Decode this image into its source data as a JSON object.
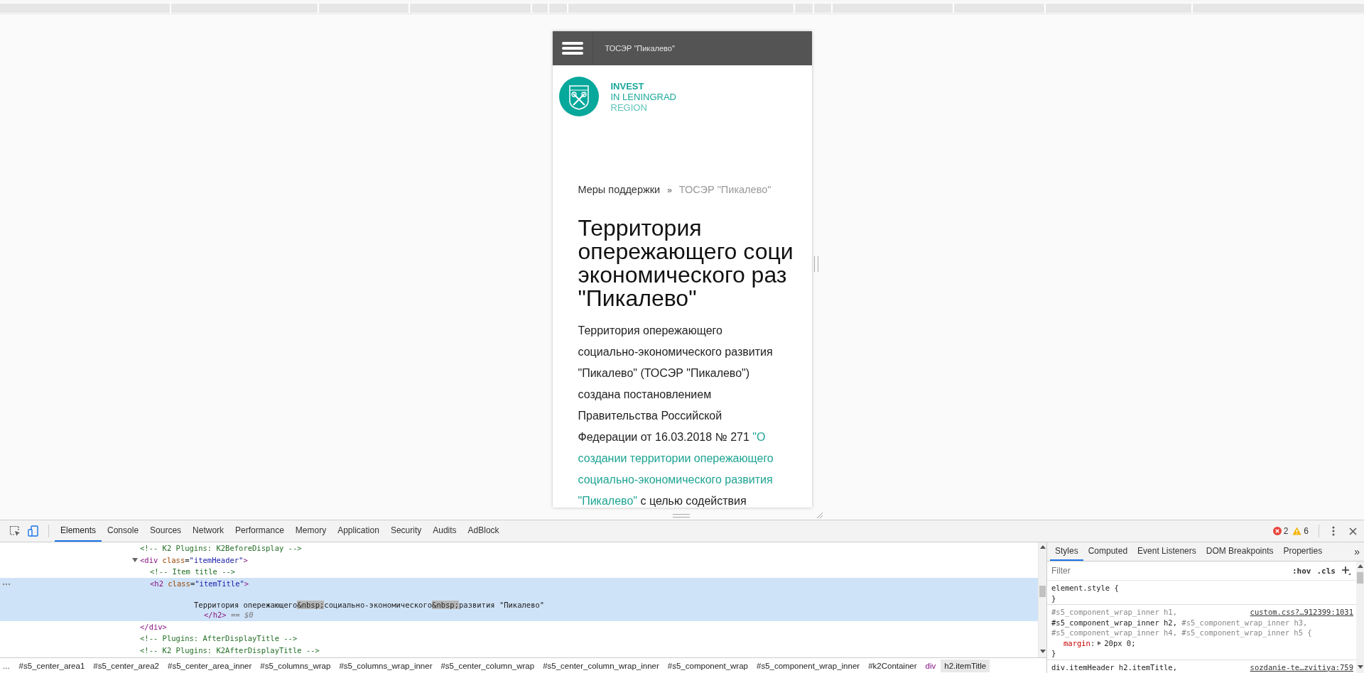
{
  "page": {
    "header": {
      "title": "ТОСЭР \"Пикалево\""
    },
    "logo": {
      "lines": [
        "INVEST",
        "IN LENINGRAD",
        "REGION"
      ]
    },
    "breadcrumb": [
      {
        "label": "Меры поддержки",
        "current": false
      },
      {
        "label": "ТОСЭР \"Пикалево\"",
        "current": true
      }
    ],
    "breadcrumb_separator": "»",
    "title_lines": [
      "Территория",
      "опережающего соци",
      "экономического раз",
      "\"Пикалево\""
    ],
    "paragraph_lines": [
      [
        {
          "text": "Территория опережающего",
          "kind": "text"
        }
      ],
      [
        {
          "text": "социально-экономического развития",
          "kind": "text"
        }
      ],
      [
        {
          "text": "\"Пикалево\" (ТОСЭР \"Пикалево\")",
          "kind": "text"
        }
      ],
      [
        {
          "text": "создана постановлением",
          "kind": "text"
        }
      ],
      [
        {
          "text": "Правительства Российской",
          "kind": "text"
        }
      ],
      [
        {
          "text": "Федерации от 16.03.2018 № 271 ",
          "kind": "text"
        },
        {
          "text": "\"О",
          "kind": "link"
        }
      ],
      [
        {
          "text": "создании территории опережающего",
          "kind": "link"
        }
      ],
      [
        {
          "text": "социально-экономического развития",
          "kind": "link"
        }
      ],
      [
        {
          "text": "\"Пикалево\"",
          "kind": "link"
        },
        {
          "text": " с целью содействия",
          "kind": "text"
        }
      ]
    ]
  },
  "devtools": {
    "tabs": [
      {
        "label": "Elements",
        "selected": true
      },
      {
        "label": "Console",
        "selected": false
      },
      {
        "label": "Sources",
        "selected": false
      },
      {
        "label": "Network",
        "selected": false
      },
      {
        "label": "Performance",
        "selected": false
      },
      {
        "label": "Memory",
        "selected": false
      },
      {
        "label": "Application",
        "selected": false
      },
      {
        "label": "Security",
        "selected": false
      },
      {
        "label": "Audits",
        "selected": false
      },
      {
        "label": "AdBlock",
        "selected": false
      }
    ],
    "errors": "2",
    "warnings": "6",
    "tree": [
      {
        "selected": false,
        "parts": [
          {
            "kind": "comment",
            "text": "<!-- K2 Plugins: K2BeforeDisplay -->"
          }
        ]
      },
      {
        "selected": false,
        "expanded": true,
        "parts": [
          {
            "kind": "tag",
            "text": "<div"
          },
          {
            "kind": "attr",
            "text": " class"
          },
          {
            "kind": "punct",
            "text": "="
          },
          {
            "kind": "value",
            "text": "\"itemHeader\""
          },
          {
            "kind": "tag",
            "text": ">"
          }
        ],
        "children": [
          {
            "selected": false,
            "parts": [
              {
                "kind": "comment",
                "text": "<!-- Item title -->"
              }
            ]
          },
          {
            "selected": true,
            "parts": [
              {
                "kind": "tag",
                "text": "<h2"
              },
              {
                "kind": "attr",
                "text": " class"
              },
              {
                "kind": "punct",
                "text": "="
              },
              {
                "kind": "value",
                "text": "\"itemTitle\""
              },
              {
                "kind": "tag",
                "text": ">"
              }
            ],
            "children": [
              {
                "kind": "text",
                "selected": false,
                "parts": [
                  {
                    "kind": "text",
                    "text": "Территория опережающего"
                  },
                  {
                    "kind": "nbsp",
                    "text": "&nbsp;"
                  },
                  {
                    "kind": "text",
                    "text": "социально-экономического"
                  },
                  {
                    "kind": "nbsp",
                    "text": "&nbsp;"
                  },
                  {
                    "kind": "text",
                    "text": "развития \"Пикалево\""
                  }
                ]
              }
            ],
            "close": [
              {
                "kind": "tag",
                "text": "</h2>"
              },
              {
                "kind": "marker",
                "text": " == $0"
              }
            ]
          }
        ],
        "close": [
          {
            "kind": "tag",
            "text": "</div>"
          }
        ]
      },
      {
        "selected": false,
        "parts": [
          {
            "kind": "comment",
            "text": "<!-- Plugins: AfterDisplayTitle -->"
          }
        ]
      },
      {
        "selected": false,
        "parts": [
          {
            "kind": "comment",
            "text": "<!-- K2 Plugins: K2AfterDisplayTitle -->"
          }
        ]
      }
    ],
    "breadcrumbs": {
      "overflow": "...",
      "items": [
        {
          "label": "#s5_center_area1",
          "kind": "id",
          "selected": false
        },
        {
          "label": "#s5_center_area2",
          "kind": "id",
          "selected": false
        },
        {
          "label": "#s5_center_area_inner",
          "kind": "id",
          "selected": false
        },
        {
          "label": "#s5_columns_wrap",
          "kind": "id",
          "selected": false
        },
        {
          "label": "#s5_columns_wrap_inner",
          "kind": "id",
          "selected": false
        },
        {
          "label": "#s5_center_column_wrap",
          "kind": "id",
          "selected": false
        },
        {
          "label": "#s5_center_column_wrap_inner",
          "kind": "id",
          "selected": false
        },
        {
          "label": "#s5_component_wrap",
          "kind": "id",
          "selected": false
        },
        {
          "label": "#s5_component_wrap_inner",
          "kind": "id",
          "selected": false
        },
        {
          "label": "#k2Container",
          "kind": "id",
          "selected": false
        },
        {
          "label": "div",
          "kind": "tag",
          "selected": false
        },
        {
          "label": "h2.itemTitle",
          "kind": "tag",
          "selected": true
        }
      ]
    },
    "styles": {
      "tabs": [
        {
          "label": "Styles",
          "selected": true
        },
        {
          "label": "Computed",
          "selected": false
        },
        {
          "label": "Event Listeners",
          "selected": false
        },
        {
          "label": "DOM Breakpoints",
          "selected": false
        },
        {
          "label": "Properties",
          "selected": false
        }
      ],
      "more": "»",
      "filter": {
        "placeholder": "Filter"
      },
      "hov": ":hov",
      "cls": ".cls",
      "rules": [
        {
          "selector_lines": [
            [
              {
                "text": "element.style {",
                "matched": true
              }
            ]
          ],
          "close": "}"
        },
        {
          "source": "custom.css?…912399:1031",
          "selector_lines": [
            [
              {
                "text": "#s5_component_wrap_inner h1,",
                "matched": false
              }
            ],
            [
              {
                "text": "#s5_component_wrap_inner h2,",
                "matched": true
              },
              {
                "text": " #s5_component_wrap_inner h3,",
                "matched": false
              }
            ],
            [
              {
                "text": "#s5_component_wrap_inner h4, #s5_component_wrap_inner h5 {",
                "matched": false
              }
            ]
          ],
          "declarations": [
            {
              "property": "margin",
              "colon": ":",
              "value": "20px 0;"
            }
          ],
          "close": "}"
        },
        {
          "source": "sozdanie-te…zvitiya:759",
          "selector_lines": [
            [
              {
                "text": "div.itemHeader h2.itemTitle,",
                "matched": true
              }
            ]
          ]
        }
      ]
    }
  }
}
